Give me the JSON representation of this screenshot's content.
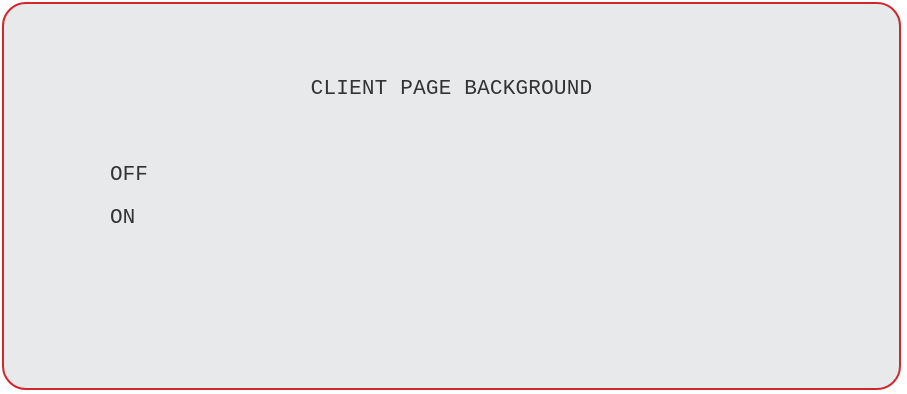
{
  "menu": {
    "title": "CLIENT PAGE BACKGROUND",
    "options": [
      {
        "label": "OFF"
      },
      {
        "label": "ON"
      }
    ]
  },
  "colors": {
    "border": "#cc2a2f",
    "panel_background": "#e8e9ea",
    "text": "#333333"
  }
}
